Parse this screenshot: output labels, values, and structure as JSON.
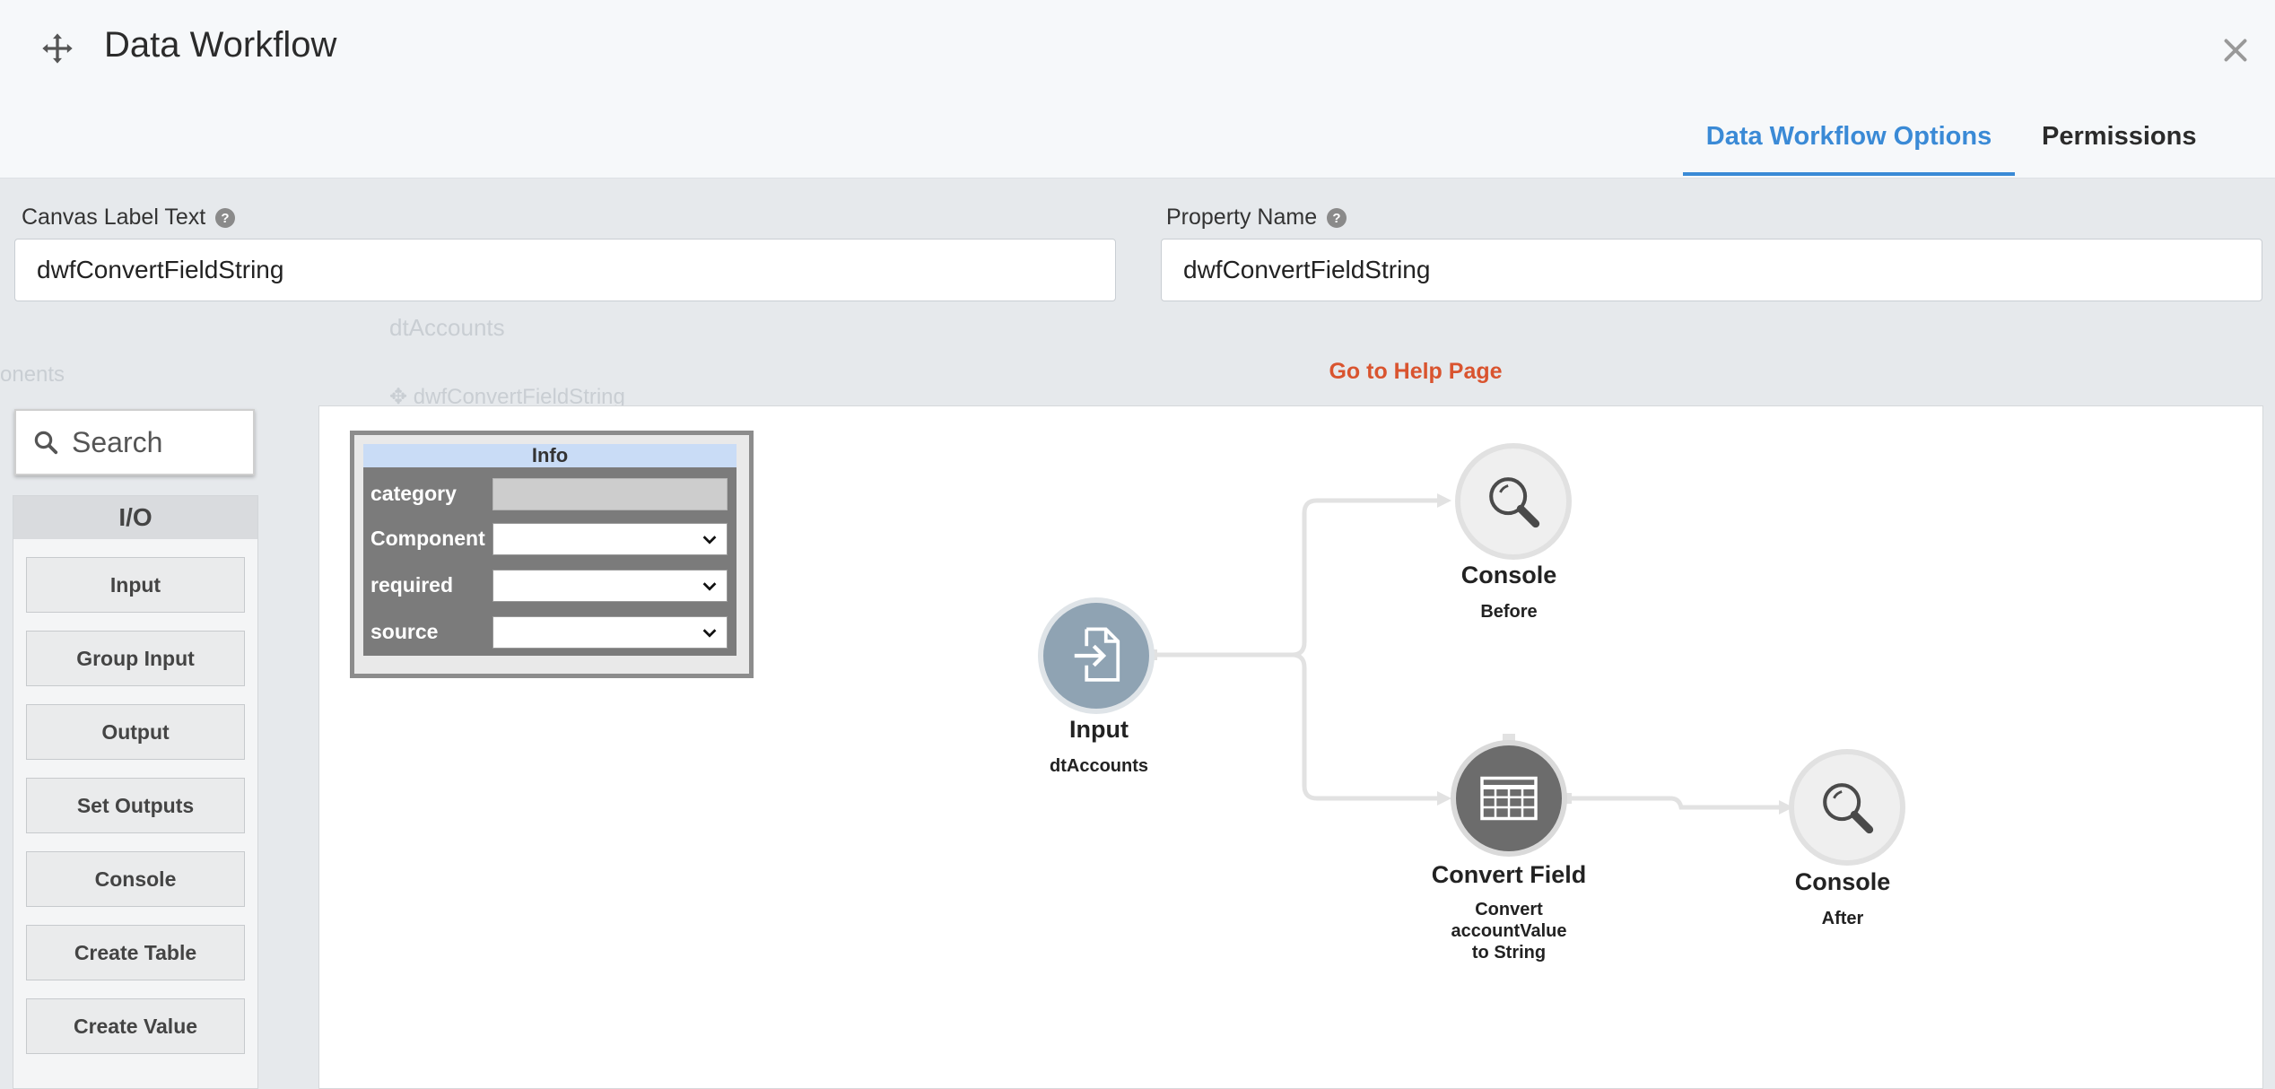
{
  "header": {
    "title": "Data Workflow",
    "tabs": [
      {
        "label": "Data Workflow Options",
        "active": true
      },
      {
        "label": "Permissions",
        "active": false
      }
    ]
  },
  "form": {
    "canvas_label": {
      "label": "Canvas Label Text",
      "value": "dwfConvertFieldString"
    },
    "property_name": {
      "label": "Property Name",
      "value": "dwfConvertFieldString"
    },
    "help_link": "Go to Help Page"
  },
  "background_ghosts": [
    "dtAccounts",
    "dwfConvertFieldString",
    "onents"
  ],
  "palette": {
    "search_placeholder": "Search",
    "section_title": "I/O",
    "items": [
      "Input",
      "Group Input",
      "Output",
      "Set Outputs",
      "Console",
      "Create Table",
      "Create Value"
    ]
  },
  "info_panel": {
    "title": "Info",
    "rows": [
      {
        "label": "category",
        "value": ""
      },
      {
        "label": "Component",
        "value": ""
      },
      {
        "label": "required",
        "value": ""
      },
      {
        "label": "source",
        "value": ""
      }
    ]
  },
  "nodes": {
    "input": {
      "title": "Input",
      "subtitle": "dtAccounts",
      "icon": "file-import-icon"
    },
    "console_before": {
      "title": "Console",
      "subtitle": "Before",
      "icon": "magnifier-icon"
    },
    "convert_field": {
      "title": "Convert Field",
      "subtitle_lines": [
        "Convert",
        "accountValue",
        "to String"
      ],
      "icon": "table-grid-icon"
    },
    "console_after": {
      "title": "Console",
      "subtitle": "After",
      "icon": "magnifier-icon"
    }
  },
  "colors": {
    "accent": "#3a8ad6",
    "help_link": "#d9542f",
    "info_header": "#c9dcf6"
  }
}
